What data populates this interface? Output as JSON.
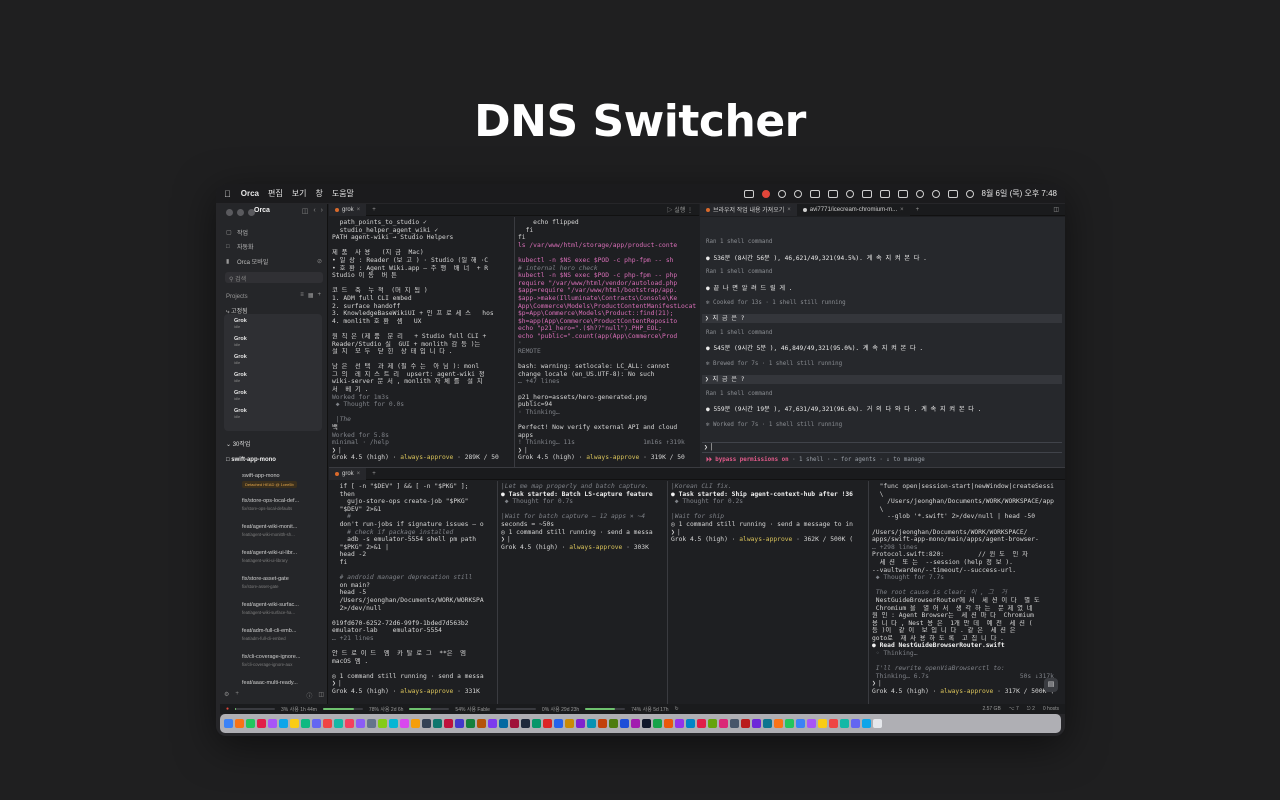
{
  "hero": {
    "title": "DNS Switcher"
  },
  "menubar": {
    "apple": "",
    "app_name": "Orca",
    "menus": [
      "편집",
      "보기",
      "창",
      "도움말"
    ],
    "clock": "8월 6일 (목) 오후 7:48"
  },
  "sidebar": {
    "app_name": "Orca",
    "nav_items": [
      {
        "icon": "work-icon",
        "label": "작업"
      },
      {
        "icon": "automation-icon",
        "label": "자동화"
      },
      {
        "icon": "mobile-icon",
        "label": "Orca 모바일"
      }
    ],
    "search_placeholder": "검색",
    "projects_label": "Projects",
    "pinned_label": "고정됨",
    "pinned": [
      {
        "name": "Grok",
        "sub": "idle"
      },
      {
        "name": "Grok",
        "sub": "idle"
      },
      {
        "name": "Grok",
        "sub": "idle"
      },
      {
        "name": "Grok",
        "sub": "idle"
      },
      {
        "name": "Grok",
        "sub": "idle"
      },
      {
        "name": "Grok",
        "sub": "idle"
      }
    ],
    "section_label": "30작업",
    "repo_label": "swift-app-mono",
    "worktrees": [
      {
        "name": "swift-app-mono",
        "sub": "Detached HEAD @ 1cee5b",
        "badge": true
      },
      {
        "name": "fix/store-ops-local-def...",
        "sub": "fix/store-ops-local-defaults"
      },
      {
        "name": "feat/agent-wiki-monit...",
        "sub": "feat/agent-wiki-monitth-sh..."
      },
      {
        "name": "feat/agent-wiki-ui-libr...",
        "sub": "feat/agent-wiki-ui-library"
      },
      {
        "name": "fix/store-asset-gate",
        "sub": "fix/store-asset-gate"
      },
      {
        "name": "feat/agent-wiki-surfac...",
        "sub": "feat/agent-wiki-surface-ha..."
      },
      {
        "name": "feat/adm-full-cli-emb...",
        "sub": "feat/adm-full-cli-embed"
      },
      {
        "name": "fix/cli-coverage-ignore...",
        "sub": "fix/cli-coverage-ignore-aux"
      },
      {
        "name": "feat/aaac-multi-ready...",
        "sub": ""
      }
    ]
  },
  "top_tabbar": {
    "tab1": "grok",
    "actions_label": "실행",
    "tab2": "브라우저 작업 내용 가져오기",
    "tab3": "avi7771/icecream-chromium-m..."
  },
  "bottom_tabbar": {
    "tab1": "grok"
  },
  "pane_top_left": {
    "lines": [
      "  path_points_to_studio ✓",
      "  studio_helper_agent_wiki ✓",
      "PATH agent-wiki → Studio Helpers",
      "",
      "제 품  사 용   (지 금  Mac)",
      "• 일 상 : Reader (보 고 ) · Studio (일 해 ·C",
      "• 호 환 : Agent Wiki.app — 주 행  배 너  + R",
      "Studio 이 동  버 튼",
      "",
      "코 드  축  누 적  (머 지 됨 )",
      "1. ADM full CLI embed",
      "2. surface handoff",
      "3. KnowledgeBaseWikiUI + 인 프 로 세 스   hos",
      "4. monlith 호 환  셈   UX",
      "",
      "원 칙 은 (제 품  분 리   + Studio full CLI +",
      "Reader/Studio 실  GUI + monlith 감 등 )는",
      "설 치  모 두  닫 힌  상 태 입 니 다 .",
      "",
      "남 은  선 택  과 제 (필 수 는  아 님 ): monl",
      "그 의  레 지 스 트 리  upsert: agent-wiki 정",
      "wiki-server 문 서 , monlith 자 체 를  설 치",
      "서  베 기 .",
      "Worked for 1m3s",
      " ◆ Thought for 0.0s",
      "",
      " │The",
      "백",
      "Worked for 5.8s",
      "minimal · /help",
      "❯ ▏",
      "Grok 4.5 (high) · always-approve · 289K / 50"
    ]
  },
  "pane_top_mid": {
    "lines": [
      "    echo flipped",
      "  fi",
      "fi",
      "ls /var/www/html/storage/app/product-conte",
      "",
      "kubectl -n $NS exec $POD -c php-fpm -- sh",
      "# internal hero check",
      "kubectl -n $NS exec $POD -c php-fpm -- php",
      "require \"/var/www/html/vendor/autoload.php",
      "$app=require \"/var/www/html/bootstrap/app.",
      "$app->make(Illuminate\\Contracts\\Console\\Ke",
      "App\\Commerce\\Models\\ProductContentManifestLocator",
      "$p=App\\Commerce\\Models\\Product::find(21);",
      "$h=app(App\\Commerce\\ProductContentReposito",
      "echo \"p21_hero=\".($h??\"null\").PHP_EOL;",
      "echo \"public=\".count(app(App\\Commerce\\Prod",
      "'",
      "REMOTE",
      "",
      "bash: warning: setlocale: LC_ALL: cannot",
      "change locale (en_US.UTF-8): No such",
      "… +47 lines",
      "",
      "p21_hero=assets/hero-generated.png",
      "public=94",
      "◦ Thinking…",
      "",
      "Perfect! Now verify external API and cloud",
      "apps",
      "! Thinking… 11s                  1m16s ↑319k",
      "❯ ▏",
      "Grok 4.5 (high) · always-approve · 319K / 50"
    ]
  },
  "chat": {
    "run1": "Ran 1 shell command",
    "msg1": "536분 (8시간 56분 ), 46,621/49,321(94.5%). 계 속  지 켜 본 다 .",
    "run2": "Ran 1 shell command",
    "msg2": "끝 나 면  알 려 드 릴 게 .",
    "note1": "✻ Cooked for 13s · 1 shell still running",
    "user1": "❯ 지 금 은 ?",
    "run3": "Ran 1 shell command",
    "msg3": "545분 (9시간 5분 ), 46,849/49,321(95.0%). 계 속  지 켜 본 다 .",
    "note2": "✻ Brewed for 7s · 1 shell still running",
    "user2": "❯ 지 금 은 ?",
    "run4": "Ran 1 shell command",
    "msg4": "559분 (9시간 19분 ), 47,631/49,321(96.6%). 거 의  다  와 다 . 계 속  지 켜 본 다 .",
    "note3": "✻ Worked for 7s · 1 shell still running",
    "prompt": "❯ ▏",
    "bypass": "⏵⏵ bypass permissions on",
    "bypass_rest": " · 1 shell · ← for agents · ↓ to manage"
  },
  "pane_b1": {
    "lines": [
      "  if [ -n \"$DEV\" ] && [ -n \"$PKG\" ];",
      "  then",
      "    gujo-store-ops create-job \"$PKG\"",
      "  \"$DEV\" 2>&1",
      "    #",
      "  don't run-jobs if signature issues — o",
      "    # check if package installed",
      "    adb -s emulator-5554 shell pm path",
      "  \"$PKG\" 2>&1 |",
      "  head -2",
      "  fi",
      "",
      "  # android manager deprecation still",
      "  on main?",
      "  head -5",
      "  /Users/jeonghan/Documents/WORK/WORKSPA",
      "  2>/dev/null",
      "",
      "019fd670-6252-72d6-99f9-1bded7d563b2",
      "emulator-lab    emulator-5554",
      "… +21 lines",
      "",
      "안 드 로 이 드  엠  카 탈 로 그  **은  엠",
      "macOS 엠 .",
      "",
      "◎ 1 command still running · send a messa",
      "❯ ▏",
      "Grok 4.5 (high) · always-approve · 331K"
    ]
  },
  "pane_b2": {
    "lines": [
      "│Let me map properly and batch capture.",
      "● Task started: Batch LS-capture feature",
      " ◆ Thought for 0.7s",
      "",
      "│Wait for batch capture — 12 apps × ~4",
      "seconds = ~50s",
      "◎ 1 command still running · send a messa",
      "❯ ▏",
      "Grok 4.5 (high) · always-approve · 303K"
    ]
  },
  "pane_b3": {
    "lines": [
      "│Korean CLI fix.",
      "● Task started: Ship agent-context-hub after !36",
      " ◆ Thought for 0.2s",
      "",
      "│Wait for ship",
      "◎ 1 command still running · send a message to in",
      "❯ ▏",
      "Grok 4.5 (high) · always-approve · 362K / 500K ("
    ]
  },
  "pane_b4": {
    "lines": [
      "  \"func open|session-start|newWindow|createSessi",
      "  \\",
      "    /Users/jeonghan/Documents/WORK/WORKSPACE/app",
      "  \\",
      "    --glob '*.swift' 2>/dev/null | head -50",
      "",
      "/Users/jeonghan/Documents/WORK/WORKSPACE/",
      "apps/swift-app-mono/main/apps/agent-browser-",
      "… +298 lines",
      "Protocol.swift:820:         // 윈 도  인 자",
      "  세 션  또 는  --session (help 정 보 ).",
      "--vaultwarden/--timeout/--success-url.",
      " ◆ Thought for 7.7s",
      "",
      " The root cause is clear: 이 , 그  거",
      " NestGuideBrowserRouter에 서  세 션 이 다  별 도",
      " Chromium 을  열 어 서  생 각 하 는  문 제 였 네",
      "원 인 : Agent Browser는  세 션 마 다  Chromium",
      "용 니 다 , Nest 용 은  1개 만 데  예 전  세 션 (",
      "등 )이  같 이  보 입 니 다 . 같 은  세 션 은",
      "goto로  재 사 용 하 도 록  고 칩 니 다 .",
      "● Read NestGuideBrowserRouter.swift",
      " ◦ Thinking…",
      "",
      " I'll rewrite openViaBrowserctl to:",
      " Thinking… 6.7s                        50s ↓317k",
      "❯ ▏",
      "Grok 4.5 (high) · always-approve · 317K / 500K ("
    ]
  },
  "wstatus": {
    "items": [
      "3% 사용 1h 44m",
      "78% 사용 2d 6h",
      "54% 사용 Fable",
      "0% 사용 29d 23h",
      "74% 사용 5d 17h"
    ],
    "right": [
      "2.57 GB",
      "⌥ 7",
      "⎋ 2",
      "0 hosts"
    ]
  },
  "progress": [
    0.03,
    0.78,
    0.54,
    0.0,
    0.74
  ],
  "colors": {
    "accent": "#d9692b",
    "approve": "#d9c35a",
    "bypass": "#e35a8a"
  }
}
